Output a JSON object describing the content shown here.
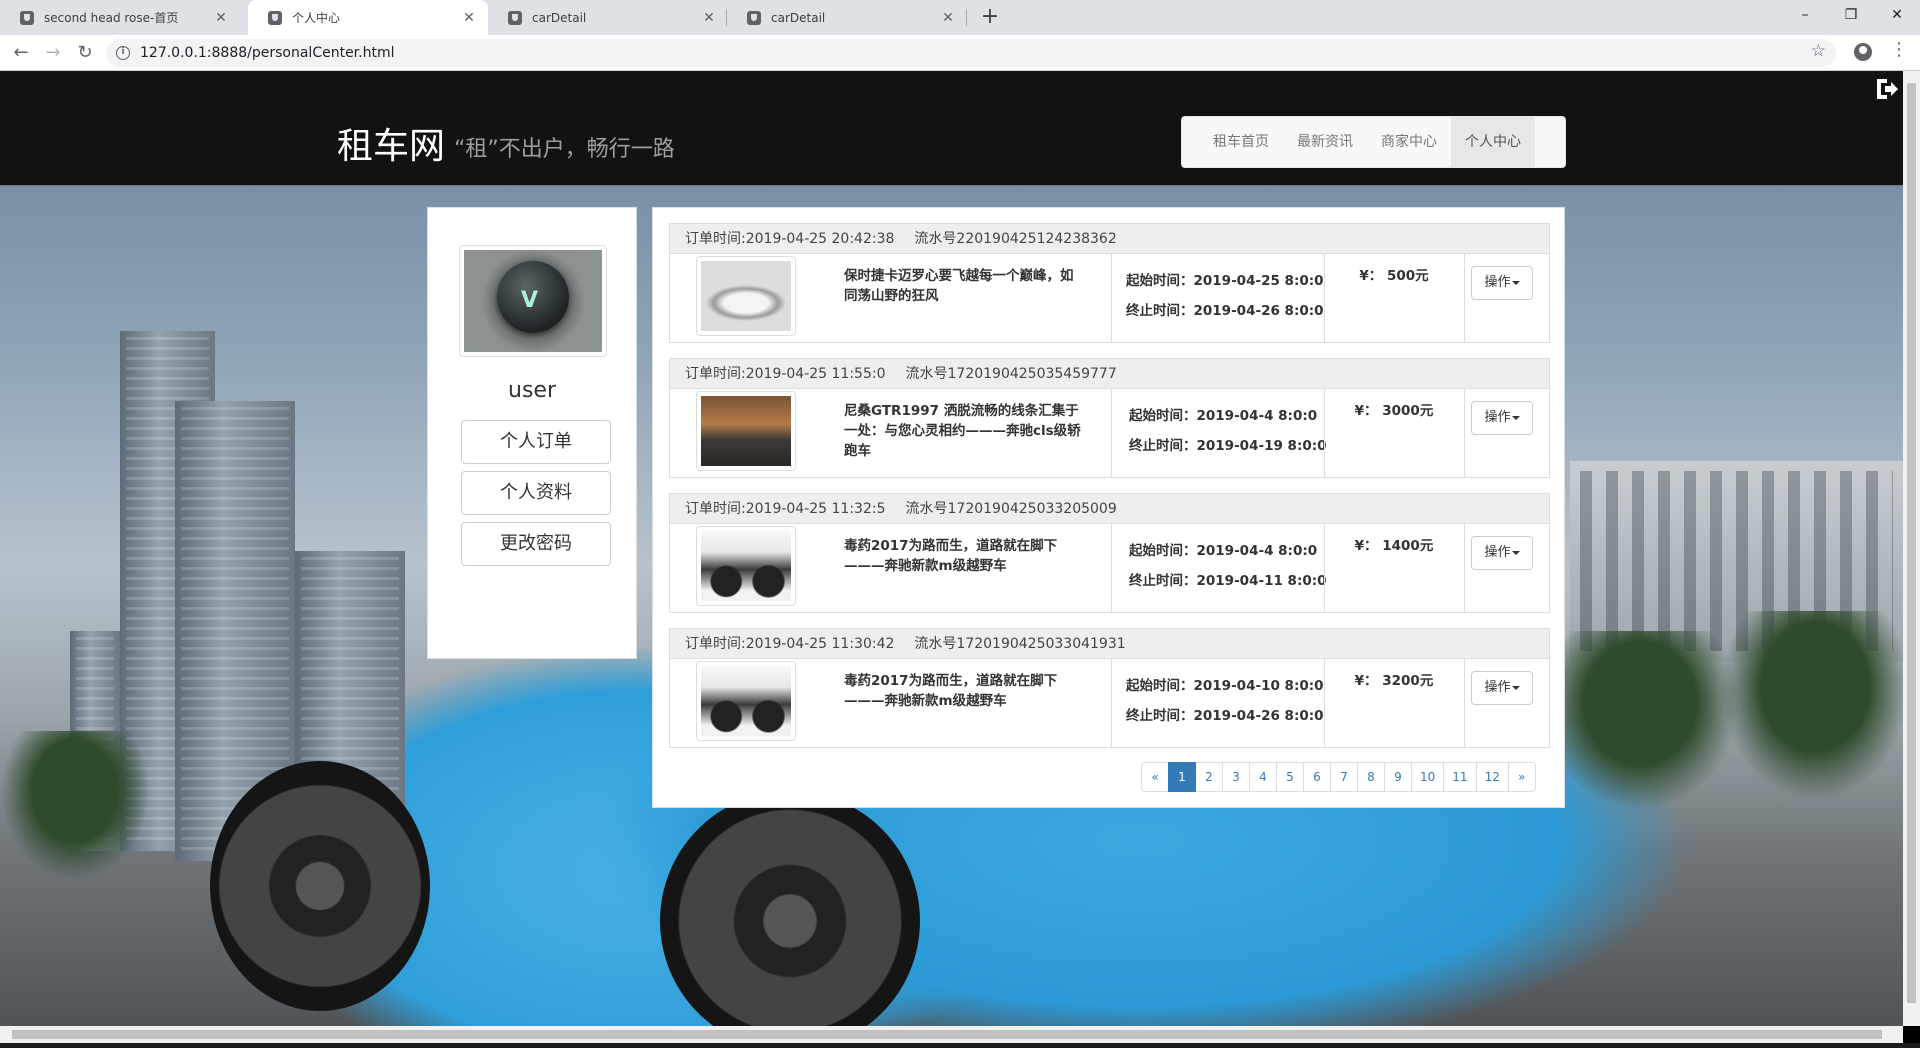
{
  "browser": {
    "tabs": [
      {
        "title": "second head rose-首页",
        "active": false
      },
      {
        "title": "个人中心",
        "active": true
      },
      {
        "title": "carDetail",
        "active": false
      },
      {
        "title": "carDetail",
        "active": false
      }
    ],
    "new_tab_icon": "+",
    "url": "127.0.0.1:8888/personalCenter.html",
    "window_controls": {
      "minimize": "–",
      "maximize": "❐",
      "close": "✕"
    }
  },
  "site": {
    "brand": "租车网",
    "slogan": "“租”不出户，畅行一路",
    "nav": [
      {
        "label": "租车首页",
        "active": false
      },
      {
        "label": "最新资讯",
        "active": false
      },
      {
        "label": "商家中心",
        "active": false
      },
      {
        "label": "个人中心",
        "active": true
      }
    ]
  },
  "profile": {
    "username": "user",
    "buttons": [
      "个人订单",
      "个人资料",
      "更改密码"
    ]
  },
  "orders": [
    {
      "order_time": "订单时间:2019-04-25 20:42:38",
      "serial": "流水号220190425124238362",
      "title": "保时捷卡迈罗心要飞越每一个巅峰，如同荡山野的狂风",
      "start": "起始时间：2019-04-25 8:0:0",
      "end": "终止时间：2019-04-26 8:0:0",
      "price": "¥： 500元",
      "action": "操作",
      "thumb": "car-white"
    },
    {
      "order_time": "订单时间:2019-04-25 11:55:0",
      "serial": "流水号1720190425035459777",
      "title": "尼桑GTR1997 洒脱流畅的线条汇集于一处：与您心灵相约———奔驰cls级轿跑车",
      "start": "起始时间：2019-04-4 8:0:0",
      "end": "终止时间：2019-04-19 8:0:0",
      "price": "¥： 3000元",
      "action": "操作",
      "thumb": "car-sedan"
    },
    {
      "order_time": "订单时间:2019-04-25 11:32:5",
      "serial": "流水号1720190425033205009",
      "title": "毒药2017为路而生，道路就在脚下———奔驰新款m级越野车",
      "start": "起始时间：2019-04-4 8:0:0",
      "end": "终止时间：2019-04-11 8:0:0",
      "price": "¥： 1400元",
      "action": "操作",
      "thumb": "bike"
    },
    {
      "order_time": "订单时间:2019-04-25 11:30:42",
      "serial": "流水号1720190425033041931",
      "title": "毒药2017为路而生，道路就在脚下———奔驰新款m级越野车",
      "start": "起始时间：2019-04-10 8:0:0",
      "end": "终止时间：2019-04-26 8:0:0",
      "price": "¥： 3200元",
      "action": "操作",
      "thumb": "bike"
    }
  ],
  "pagination": {
    "prev": "«",
    "pages": [
      "1",
      "2",
      "3",
      "4",
      "5",
      "6",
      "7",
      "8",
      "9",
      "10",
      "11",
      "12"
    ],
    "active": "1",
    "next": "»"
  },
  "icons": {
    "back": "back-arrow-icon",
    "forward": "forward-arrow-icon",
    "reload": "reload-icon",
    "info": "info-icon",
    "star": "star-icon",
    "logout": "logout-icon"
  },
  "colors": {
    "header_bg": "#121212",
    "pagination_active": "#337ab7"
  }
}
